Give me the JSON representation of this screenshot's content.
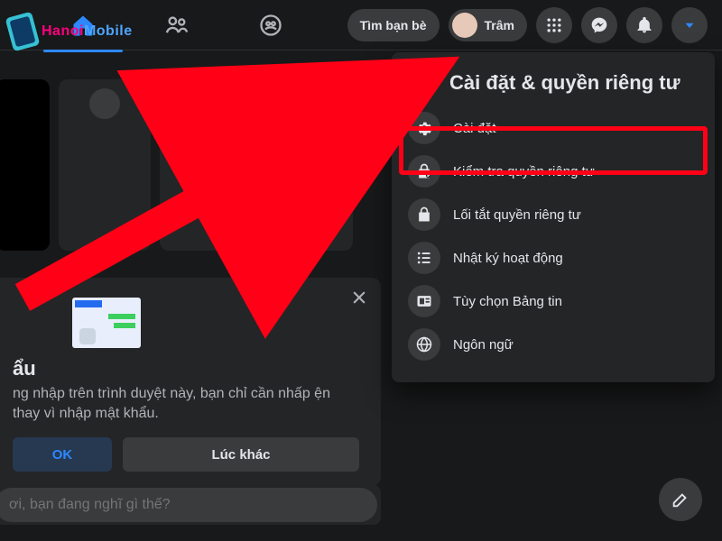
{
  "watermark": {
    "part1": "Hanoi",
    "part2": "Mobile"
  },
  "nav": {
    "find_friends": "Tìm bạn bè",
    "user_name": "Trâm"
  },
  "prompt": {
    "title_partial": "ẩu",
    "desc_partial": "ng nhập trên trình duyệt này, bạn chỉ cần nhấp ện thay vì nhập mật khẩu.",
    "ok": "OK",
    "later": "Lúc khác"
  },
  "composer": {
    "placeholder_partial": "ơi, bạn đang nghĩ gì thế?"
  },
  "dropdown": {
    "title": "Cài đặt & quyền riêng tư",
    "items": [
      {
        "label": "Cài đặt",
        "icon": "gear-icon"
      },
      {
        "label": "Kiểm tra quyền riêng tư",
        "icon": "lock-check-icon"
      },
      {
        "label": "Lối tắt quyền riêng tư",
        "icon": "lock-icon"
      },
      {
        "label": "Nhật ký hoạt động",
        "icon": "list-icon"
      },
      {
        "label": "Tùy chọn Bảng tin",
        "icon": "news-icon"
      },
      {
        "label": "Ngôn ngữ",
        "icon": "globe-icon"
      }
    ]
  }
}
